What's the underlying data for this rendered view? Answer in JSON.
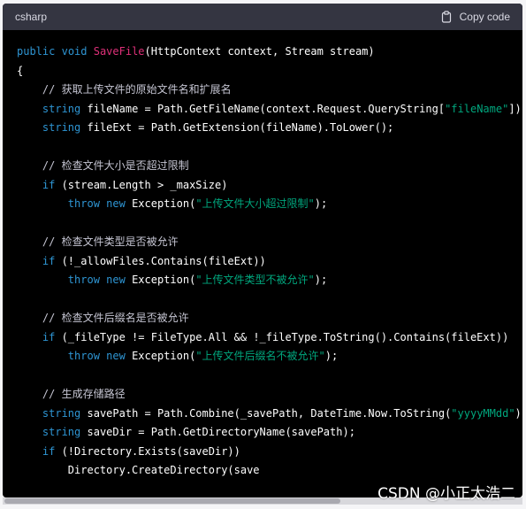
{
  "header": {
    "language": "csharp",
    "copy_label": "Copy code"
  },
  "watermark": "CSDN @小正太浩二",
  "code_lines": [
    [
      [
        "kw",
        "public"
      ],
      [
        "pl",
        " "
      ],
      [
        "kw",
        "void"
      ],
      [
        "pl",
        " "
      ],
      [
        "fn",
        "SaveFile"
      ],
      [
        "pl",
        "(HttpContext context, Stream stream)"
      ]
    ],
    [
      [
        "pl",
        "{"
      ]
    ],
    [
      [
        "pl",
        "    "
      ],
      [
        "cm",
        "// 获取上传文件的原始文件名和扩展名"
      ]
    ],
    [
      [
        "pl",
        "    "
      ],
      [
        "ty",
        "string"
      ],
      [
        "pl",
        " fileName = Path.GetFileName(context.Request.QueryString["
      ],
      [
        "str",
        "\"fileName\""
      ],
      [
        "pl",
        "]);"
      ]
    ],
    [
      [
        "pl",
        "    "
      ],
      [
        "ty",
        "string"
      ],
      [
        "pl",
        " fileExt = Path.GetExtension(fileName).ToLower();"
      ]
    ],
    [
      [
        "pl",
        ""
      ]
    ],
    [
      [
        "pl",
        "    "
      ],
      [
        "cm",
        "// 检查文件大小是否超过限制"
      ]
    ],
    [
      [
        "pl",
        "    "
      ],
      [
        "kw",
        "if"
      ],
      [
        "pl",
        " (stream.Length > _maxSize)"
      ]
    ],
    [
      [
        "pl",
        "        "
      ],
      [
        "kw",
        "throw"
      ],
      [
        "pl",
        " "
      ],
      [
        "kw",
        "new"
      ],
      [
        "pl",
        " Exception("
      ],
      [
        "str",
        "\"上传文件大小超过限制\""
      ],
      [
        "pl",
        ");"
      ]
    ],
    [
      [
        "pl",
        ""
      ]
    ],
    [
      [
        "pl",
        "    "
      ],
      [
        "cm",
        "// 检查文件类型是否被允许"
      ]
    ],
    [
      [
        "pl",
        "    "
      ],
      [
        "kw",
        "if"
      ],
      [
        "pl",
        " (!_allowFiles.Contains(fileExt))"
      ]
    ],
    [
      [
        "pl",
        "        "
      ],
      [
        "kw",
        "throw"
      ],
      [
        "pl",
        " "
      ],
      [
        "kw",
        "new"
      ],
      [
        "pl",
        " Exception("
      ],
      [
        "str",
        "\"上传文件类型不被允许\""
      ],
      [
        "pl",
        ");"
      ]
    ],
    [
      [
        "pl",
        ""
      ]
    ],
    [
      [
        "pl",
        "    "
      ],
      [
        "cm",
        "// 检查文件后缀名是否被允许"
      ]
    ],
    [
      [
        "pl",
        "    "
      ],
      [
        "kw",
        "if"
      ],
      [
        "pl",
        " (_fileType != FileType.All && !_fileType.ToString().Contains(fileExt))"
      ]
    ],
    [
      [
        "pl",
        "        "
      ],
      [
        "kw",
        "throw"
      ],
      [
        "pl",
        " "
      ],
      [
        "kw",
        "new"
      ],
      [
        "pl",
        " Exception("
      ],
      [
        "str",
        "\"上传文件后缀名不被允许\""
      ],
      [
        "pl",
        ");"
      ]
    ],
    [
      [
        "pl",
        ""
      ]
    ],
    [
      [
        "pl",
        "    "
      ],
      [
        "cm",
        "// 生成存储路径"
      ]
    ],
    [
      [
        "pl",
        "    "
      ],
      [
        "ty",
        "string"
      ],
      [
        "pl",
        " savePath = Path.Combine(_savePath, DateTime.Now.ToString("
      ],
      [
        "str",
        "\"yyyyMMdd\""
      ],
      [
        "pl",
        "), P"
      ]
    ],
    [
      [
        "pl",
        "    "
      ],
      [
        "ty",
        "string"
      ],
      [
        "pl",
        " saveDir = Path.GetDirectoryName(savePath);"
      ]
    ],
    [
      [
        "pl",
        "    "
      ],
      [
        "kw",
        "if"
      ],
      [
        "pl",
        " (!Directory.Exists(saveDir))"
      ]
    ],
    [
      [
        "pl",
        "        Directory.CreateDirectory(save"
      ]
    ]
  ]
}
